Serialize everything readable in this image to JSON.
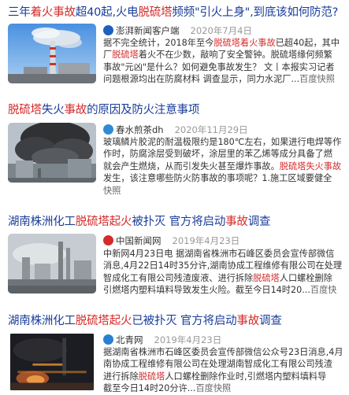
{
  "results": [
    {
      "title_parts": [
        {
          "t": "三年",
          "hl": false
        },
        {
          "t": "着火事故",
          "hl": true
        },
        {
          "t": "超40起,火电",
          "hl": false
        },
        {
          "t": "脱硫塔",
          "hl": true
        },
        {
          "t": "频频\"引火上身\",到底该如何防范?",
          "hl": false
        }
      ],
      "source": "澎湃新闻客户端",
      "source_icon_color": "#1f5fbf",
      "date": "2020年7月4日",
      "lines": [
        [
          {
            "t": "据不完全统计，2018年至今",
            "hl": false
          },
          {
            "t": "脱硫塔着火事故",
            "hl": true
          },
          {
            "t": "已超40起，其中",
            "hl": false
          }
        ],
        [
          {
            "t": "厂",
            "hl": false
          },
          {
            "t": "脱硫塔",
            "hl": true
          },
          {
            "t": "着火不在少数，敲响了安全警钟。脱硫塔缘何频繁",
            "hl": false
          }
        ],
        [
          {
            "t": "事故\"元凶\"是什么？如何避免事故发生？ 文丨本报实习记者",
            "hl": false
          }
        ],
        [
          {
            "t": "问题根源均出在防腐材料 调查显示，同力水泥厂...",
            "hl": false
          },
          {
            "t": "百度快照",
            "hl": false,
            "cls": "quick"
          }
        ]
      ]
    },
    {
      "title_parts": [
        {
          "t": "脱硫塔",
          "hl": true
        },
        {
          "t": "失火",
          "hl": false
        },
        {
          "t": "事故",
          "hl": true
        },
        {
          "t": "的原因及防火注意事项",
          "hl": false
        }
      ],
      "source": "春水煎茶dh",
      "source_icon_color": "#2e8bd6",
      "date": "2020年11月29日",
      "lines": [
        [
          {
            "t": "玻璃鳞片胶泥的耐温极限约是180℃左右，如果进行电焊等作",
            "hl": false
          }
        ],
        [
          {
            "t": "作时，防腐涂层受到破坏，涂层里的苯乙烯等成分具备了燃",
            "hl": false
          }
        ],
        [
          {
            "t": "就会产生燃烧，从而引发失火甚至爆炸事故。",
            "hl": false
          },
          {
            "t": "脱硫塔失火事故",
            "hl": true
          }
        ],
        [
          {
            "t": "发生，该注意哪些防火防事故的事项呢？1.施工区域要健全",
            "hl": false
          }
        ],
        [
          {
            "t": "快照",
            "hl": false,
            "cls": "quick"
          }
        ]
      ]
    },
    {
      "title_parts": [
        {
          "t": "湖南株洲化工",
          "hl": false
        },
        {
          "t": "脱硫塔起火",
          "hl": true
        },
        {
          "t": "被扑灭 官方将启动",
          "hl": false
        },
        {
          "t": "事故",
          "hl": true
        },
        {
          "t": "调查",
          "hl": false
        }
      ],
      "source": "中国新闻网",
      "source_icon_color": "#d42b2b",
      "date": "2019年4月23日",
      "lines": [
        [
          {
            "t": "中新网4月23日电 据湖南省株洲市石峰区委员会宣传部微信",
            "hl": false
          }
        ],
        [
          {
            "t": "消息,4月22日14时35分许,湖南协成工程维修有限公司在处理",
            "hl": false
          }
        ],
        [
          {
            "t": "智成化工有限公司残渣废液、进行拆除",
            "hl": false
          },
          {
            "t": "脱硫塔",
            "hl": true
          },
          {
            "t": "人口螺栓删除",
            "hl": false
          }
        ],
        [
          {
            "t": "引燃塔内塑料填料导致发生火险。截至今日14时20...",
            "hl": false
          },
          {
            "t": "百度快",
            "hl": false,
            "cls": "quick"
          }
        ]
      ]
    },
    {
      "title_parts": [
        {
          "t": "湖南株洲化工",
          "hl": false
        },
        {
          "t": "脱硫塔起火",
          "hl": true
        },
        {
          "t": "已被扑灭 官方将启动",
          "hl": false
        },
        {
          "t": "事故",
          "hl": true
        },
        {
          "t": "调查",
          "hl": false
        }
      ],
      "source": "北青网",
      "source_icon_color": "#2a7fd4",
      "date": "2019年4月23日",
      "lines": [
        [
          {
            "t": "据湖南省株洲市石峰区委员会宣传部微信公众号23日消息,4月",
            "hl": false
          }
        ],
        [
          {
            "t": "南协成工程维修有限公司在处理湖南智成化工有限公司残渣",
            "hl": false
          }
        ],
        [
          {
            "t": "进行拆除",
            "hl": false
          },
          {
            "t": "脱硫塔",
            "hl": true
          },
          {
            "t": "人口螺栓删除作业时,引燃塔内塑料填料导",
            "hl": false
          }
        ],
        [
          {
            "t": "截至今日14时20分许...",
            "hl": false
          },
          {
            "t": "百度快照",
            "hl": false,
            "cls": "quick"
          }
        ]
      ]
    }
  ]
}
